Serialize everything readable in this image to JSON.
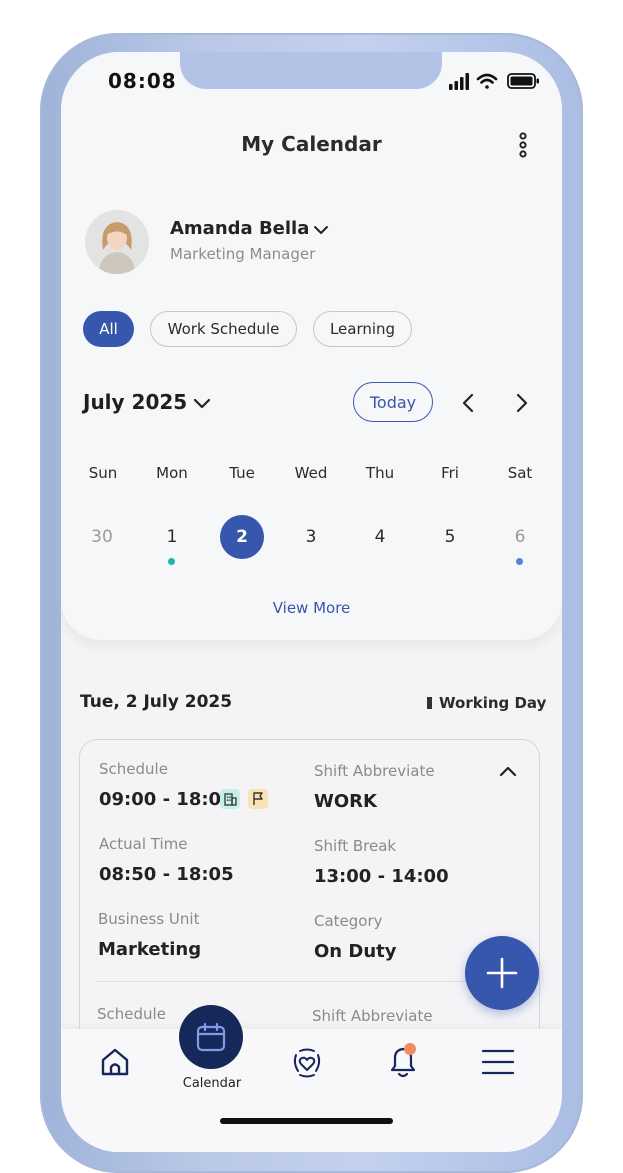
{
  "status_bar": {
    "time": "08:08"
  },
  "header": {
    "title": "My Calendar"
  },
  "profile": {
    "name": "Amanda Bella",
    "role": "Marketing Manager"
  },
  "filters": [
    {
      "label": "All",
      "selected": true
    },
    {
      "label": "Work Schedule",
      "selected": false
    },
    {
      "label": "Learning",
      "selected": false
    }
  ],
  "calendar": {
    "month_label": "July 2025",
    "today_label": "Today",
    "weekdays": [
      "Sun",
      "Mon",
      "Tue",
      "Wed",
      "Thu",
      "Fri",
      "Sat"
    ],
    "dates": [
      "30",
      "1",
      "2",
      "3",
      "4",
      "5",
      "6"
    ],
    "selected_date": "2",
    "view_more_label": "View More",
    "colors": {
      "accent": "#3756ad",
      "event_teal": "#1fb3b0",
      "event_blue": "#4f86d8"
    }
  },
  "day_detail": {
    "date_label": "Tue, 2  July  2025",
    "day_type": "Working Day",
    "entry": {
      "schedule_label": "Schedule",
      "schedule_value": "09:00 - 18:00",
      "shift_abbrev_label": "Shift Abbreviate",
      "shift_abbrev_value": "WORK",
      "actual_time_label": "Actual Time",
      "actual_time_value": "08:50 - 18:05",
      "shift_break_label": "Shift Break",
      "shift_break_value": "13:00 - 14:00",
      "business_unit_label": "Business Unit",
      "business_unit_value": "Marketing",
      "category_label": "Category",
      "category_value": "On Duty"
    },
    "next_entry": {
      "schedule_label": "Schedule",
      "shift_abbrev_label": "Shift Abbreviate"
    }
  },
  "bottom_nav": {
    "active_label": "Calendar",
    "icons": [
      "home-icon",
      "calendar-icon",
      "heart-shield-icon",
      "bell-icon",
      "menu-icon"
    ]
  }
}
